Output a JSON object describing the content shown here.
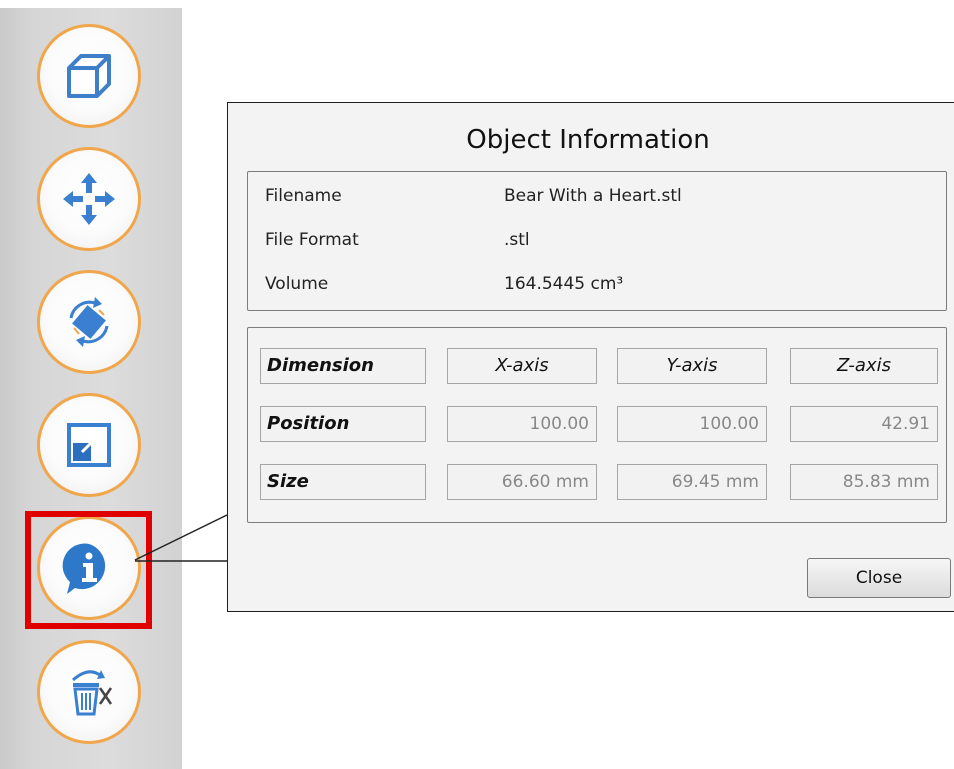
{
  "toolbar": {
    "buttons": [
      {
        "name": "view-cube",
        "icon": "cube-icon"
      },
      {
        "name": "move",
        "icon": "move-arrows-icon"
      },
      {
        "name": "rotate",
        "icon": "rotate-icon"
      },
      {
        "name": "scale",
        "icon": "scale-icon"
      },
      {
        "name": "info",
        "icon": "info-icon",
        "selected": true
      },
      {
        "name": "delete",
        "icon": "trash-icon"
      }
    ],
    "accent": "#f0a64a",
    "icon_color": "#3a7fd0",
    "highlight_color": "#e00000"
  },
  "dialog": {
    "title": "Object Information",
    "filename_label": "Filename",
    "filename_value": "Bear With a Heart.stl",
    "format_label": "File Format",
    "format_value": ".stl",
    "volume_label": "Volume",
    "volume_value": "164.5445 cm³",
    "table": {
      "header": [
        "Dimension",
        "X-axis",
        "Y-axis",
        "Z-axis"
      ],
      "position_label": "Position",
      "position": [
        "100.00",
        "100.00",
        "42.91"
      ],
      "size_label": "Size",
      "size": [
        "66.60 mm",
        "69.45 mm",
        "85.83 mm"
      ]
    },
    "close_label": "Close"
  }
}
